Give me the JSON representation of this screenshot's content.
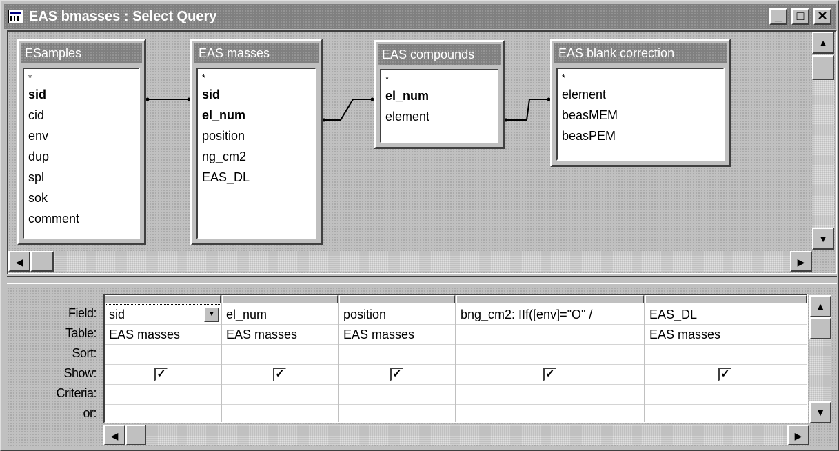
{
  "window": {
    "title": "EAS bmasses : Select Query",
    "icon": "query-icon",
    "controls": {
      "minimize": "_",
      "maximize": "□",
      "close": "✕"
    }
  },
  "tables": [
    {
      "name": "ESamples",
      "fields": [
        {
          "label": "*",
          "key": false,
          "star": true
        },
        {
          "label": "sid",
          "key": true
        },
        {
          "label": "cid",
          "key": false
        },
        {
          "label": "env",
          "key": false
        },
        {
          "label": "dup",
          "key": false
        },
        {
          "label": "spl",
          "key": false
        },
        {
          "label": "sok",
          "key": false
        },
        {
          "label": "comment",
          "key": false
        }
      ]
    },
    {
      "name": "EAS masses",
      "fields": [
        {
          "label": "*",
          "key": false,
          "star": true
        },
        {
          "label": "sid",
          "key": true
        },
        {
          "label": "el_num",
          "key": true
        },
        {
          "label": "position",
          "key": false
        },
        {
          "label": "ng_cm2",
          "key": false
        },
        {
          "label": "EAS_DL",
          "key": false
        }
      ]
    },
    {
      "name": "EAS compounds",
      "fields": [
        {
          "label": "*",
          "key": false,
          "star": true
        },
        {
          "label": "el_num",
          "key": true
        },
        {
          "label": "element",
          "key": false
        }
      ]
    },
    {
      "name": "EAS blank correction",
      "fields": [
        {
          "label": "*",
          "key": false,
          "star": true
        },
        {
          "label": "element",
          "key": false
        },
        {
          "label": "beasMEM",
          "key": false
        },
        {
          "label": "beasPEM",
          "key": false
        }
      ]
    }
  ],
  "grid": {
    "row_labels": {
      "field": "Field:",
      "table": "Table:",
      "sort": "Sort:",
      "show": "Show:",
      "criteria": "Criteria:",
      "or": "or:"
    },
    "columns": [
      {
        "field": "sid",
        "table": "EAS masses",
        "sort": "",
        "show": true,
        "criteria": "",
        "or": ""
      },
      {
        "field": "el_num",
        "table": "EAS masses",
        "sort": "",
        "show": true,
        "criteria": "",
        "or": ""
      },
      {
        "field": "position",
        "table": "EAS masses",
        "sort": "",
        "show": true,
        "criteria": "",
        "or": ""
      },
      {
        "field": "bng_cm2: IIf([env]=\"O\" /",
        "table": "",
        "sort": "",
        "show": true,
        "criteria": "",
        "or": ""
      },
      {
        "field": "EAS_DL",
        "table": "EAS masses",
        "sort": "",
        "show": true,
        "criteria": "",
        "or": ""
      }
    ],
    "check_glyph": "✓"
  },
  "scroll": {
    "up": "▲",
    "down": "▼",
    "left": "◀",
    "right": "▶"
  }
}
